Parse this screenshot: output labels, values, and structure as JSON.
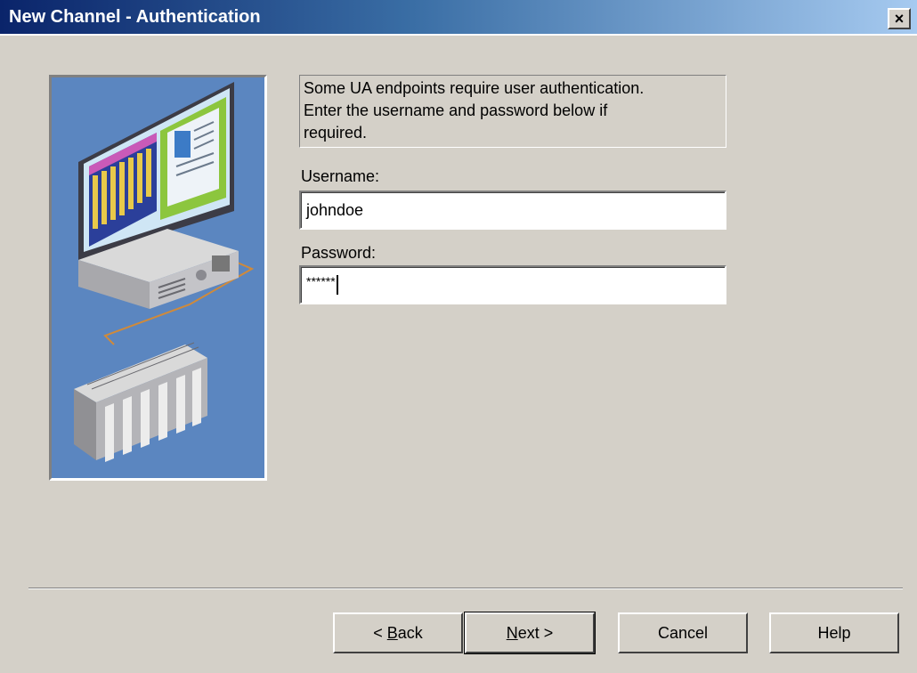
{
  "window": {
    "title": "New Channel - Authentication",
    "close_glyph": "×"
  },
  "description": {
    "line1": "Some UA endpoints require user authentication.",
    "line2": "Enter the username and password below if",
    "line3": "required."
  },
  "username": {
    "label": "Username:",
    "value": "johndoe"
  },
  "password": {
    "label": "Password:",
    "masked_value": "******"
  },
  "buttons": {
    "back": {
      "arrow": "<",
      "mnemonic": "B",
      "rest": "ack"
    },
    "next": {
      "mnemonic": "N",
      "rest": "ext",
      "arrow": ">"
    },
    "cancel": "Cancel",
    "help": "Help"
  },
  "icons": {
    "illustration": "computer-and-plc-illustration",
    "close": "close-icon"
  },
  "colors": {
    "titlebar_start": "#0a246a",
    "titlebar_end": "#a6caf0",
    "dialog_bg": "#d4d0c8",
    "illustration_bg": "#5b86c0"
  }
}
